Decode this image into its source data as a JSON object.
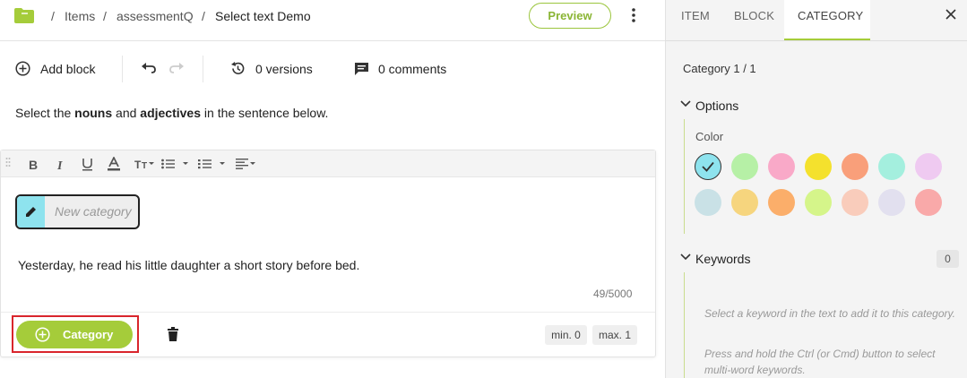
{
  "breadcrumb": {
    "folder_icon": "folder-icon",
    "items": [
      "Items",
      "assessmentQ",
      "Select text Demo"
    ],
    "separator": "/"
  },
  "header": {
    "preview_label": "Preview",
    "more_icon": "kebab-menu-icon"
  },
  "toolbar": {
    "add_block_label": "Add block",
    "versions_label": "0 versions",
    "comments_label": "0 comments"
  },
  "question": {
    "prefix": "Select the ",
    "bold1": "nouns",
    "middle": " and ",
    "bold2": "adjectives",
    "suffix": " in the sentence below."
  },
  "editor": {
    "new_category_placeholder": "New category",
    "sentence": "Yesterday, he read his little daughter a short story before bed.",
    "char_count": "49/5000"
  },
  "footer": {
    "category_button": "Category",
    "min_label": "min. 0",
    "max_label": "max. 1"
  },
  "panel": {
    "tabs": [
      "ITEM",
      "BLOCK",
      "CATEGORY"
    ],
    "active_tab": "CATEGORY",
    "category_count": "Category 1 / 1",
    "options_title": "Options",
    "color_label": "Color",
    "colors": [
      "#8ee3ee",
      "#b6f0a6",
      "#f9a9c8",
      "#f4e12d",
      "#f99f7a",
      "#a4efde",
      "#efcaf1",
      "#c9e1e6",
      "#f6d57e",
      "#fbae6a",
      "#d5f58a",
      "#f9ccbb",
      "#e2e0ef",
      "#f9a9a9"
    ],
    "selected_color_index": 0,
    "keywords_title": "Keywords",
    "keywords_count": "0",
    "hint1": "Select a keyword in the text to add it to this category.",
    "hint2": "Press and hold the Ctrl (or Cmd) button to select multi-word keywords."
  }
}
